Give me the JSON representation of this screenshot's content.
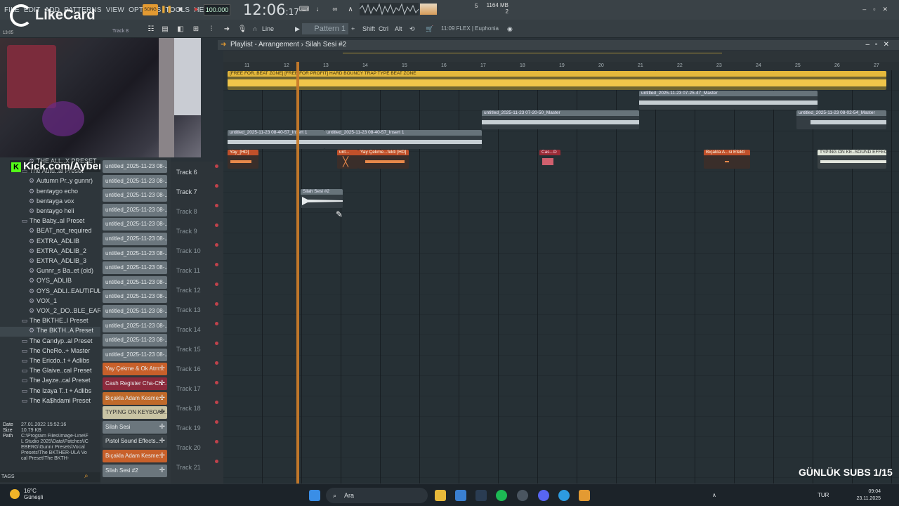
{
  "menu": [
    "FILE",
    "EDIT",
    "ADD",
    "PATTERNS",
    "VIEW",
    "OPTIONS",
    "TOOLS",
    "HELP"
  ],
  "transport": {
    "mode": "SONG",
    "tempo": "100.000",
    "time": "12:06",
    "time_ticks": "17",
    "mem": "1164 MB",
    "mem2": "2",
    "mem_num": "5"
  },
  "toolbar": {
    "pattern": "Pattern 1",
    "snap": "Line",
    "shift": "Shift",
    "ctrl": "Ctrl",
    "alt": "Alt",
    "hint": "11:09  FLEX | Euphonia",
    "track_label": "Track 8"
  },
  "playlist": {
    "title": "Playlist - Arrangement",
    "pattern": "Silah Sesi #2",
    "ruler": [
      "11",
      "12",
      "13",
      "14",
      "15",
      "16",
      "17",
      "18",
      "19",
      "20",
      "21",
      "22",
      "23",
      "24",
      "25",
      "26",
      "27"
    ]
  },
  "clips": {
    "beat": "[FREE FOR..BEAT ZONE] [FREE FOR PROFIT] HARD BOUNCY TRAP TYPE BEAT ZONE",
    "master1": "untitled_2025-11-23 07-25-47_Master",
    "master2": "untitled_2025-11-23 07-20-50_Master",
    "master3": "untitled_2025-11-23 08-02-54_Master",
    "insert1": "untitled_2025-11-23 08-40-57_Insert 1",
    "insert2": "untitled_2025-11-23 08-40-57_Insert 1",
    "yay1": "Yay_[HD]",
    "yay2": "unt...",
    "yay3": "Yay Çekme...fekti [HD]",
    "cash": "Cas...D",
    "bicak": "Bıçakla A...si Efekti",
    "typing": "TYPING ON KE..SOUND EFFECT",
    "silah": "Silah Sesi #2"
  },
  "tracks": [
    "Track 6",
    "Track 7",
    "Track 8",
    "Track 9",
    "Track 10",
    "Track 11",
    "Track 12",
    "Track 13",
    "Track 14",
    "Track 15",
    "Track 16",
    "Track 17",
    "Track 18",
    "Track 19",
    "Track 20",
    "Track 21"
  ],
  "browser": {
    "items": [
      "THE ALL..X PRESET",
      "The Autu..al Preset",
      "Autumn Pr..y gunnr)",
      "bentaygo echo",
      "bentayga vox",
      "bentaygo heli",
      "The Baby..al Preset",
      "BEAT_not_required",
      "EXTRA_ADLIB",
      "EXTRA_ADLIB_2",
      "EXTRA_ADLIB_3",
      "Gunnr_s Ba..et (old)",
      "OYS_ADLIB",
      "OYS_ADLI..EAUTIFUL",
      "VOX_1",
      "VOX_2_DO..BLE_EAR",
      "The BKTHE..l Preset",
      "The BKTH..A Preset",
      "The Candyp..al Preset",
      "The CheRo..+ Master",
      "The Ericdo..t + Adlibs",
      "The Glaive..cal Preset",
      "The Jayze..cal Preset",
      "The Izaya T..t + Adlibs",
      "The Ka$hdami Preset"
    ],
    "info_date": "27.01.2022 15:52:16",
    "info_size": "10.79 KB",
    "info_path": "C:\\Program Files\\Image-Line\\FL Studio 2025\\Data\\Patches\\ICEBERG\\Gunnr Presets\\Vocal Presets\\The BKTHER-ULA Vocal Preset\\The BKTH-",
    "tags": "TAGS",
    "labels": {
      "date": "Date",
      "size": "Size",
      "path": "Path"
    }
  },
  "channels": [
    "untitled_2025-11-23 08-...",
    "untitled_2025-11-23 08-...",
    "untitled_2025-11-23 08-...",
    "untitled_2025-11-23 08-...",
    "untitled_2025-11-23 08-...",
    "untitled_2025-11-23 08-...",
    "untitled_2025-11-23 08-...",
    "untitled_2025-11-23 08-...",
    "untitled_2025-11-23 08-...",
    "untitled_2025-11-23 08-...",
    "untitled_2025-11-23 08-...",
    "untitled_2025-11-23 08-...",
    "untitled_2025-11-23 08-...",
    "untitled_2025-11-23 08-...",
    "Yay Çekme & Ok Atm...",
    "Cash Register Cha-Ch...",
    "Bıçakla Adam Kesme...",
    "TYPING ON KEYBOAR...",
    "Silah Sesi",
    "Pistol Sound Effects...",
    "Bıçakla Adam Kesme...",
    "Silah Sesi #2"
  ],
  "channel_colors": [
    "#6b767d",
    "#6b767d",
    "#6b767d",
    "#6b767d",
    "#6b767d",
    "#6b767d",
    "#6b767d",
    "#6b767d",
    "#6b767d",
    "#6b767d",
    "#6b767d",
    "#6b767d",
    "#6b767d",
    "#6b767d",
    "#c8602a",
    "#8c2a3c",
    "#c06a2a",
    "#c9c4a4",
    "#6b767d",
    "#3a4247",
    "#c8602a",
    "#6b767d"
  ],
  "overlay": {
    "logo": "LikeCard",
    "kick": "Kick.com/Ayberk",
    "subs": "GÜNLÜK SUBS 1/15",
    "small_time": "13:05"
  },
  "taskbar": {
    "temp": "16°C",
    "weather": "Güneşli",
    "search": "Ara",
    "lang": "TUR",
    "time": "09:04",
    "date": "23.11.2025"
  }
}
